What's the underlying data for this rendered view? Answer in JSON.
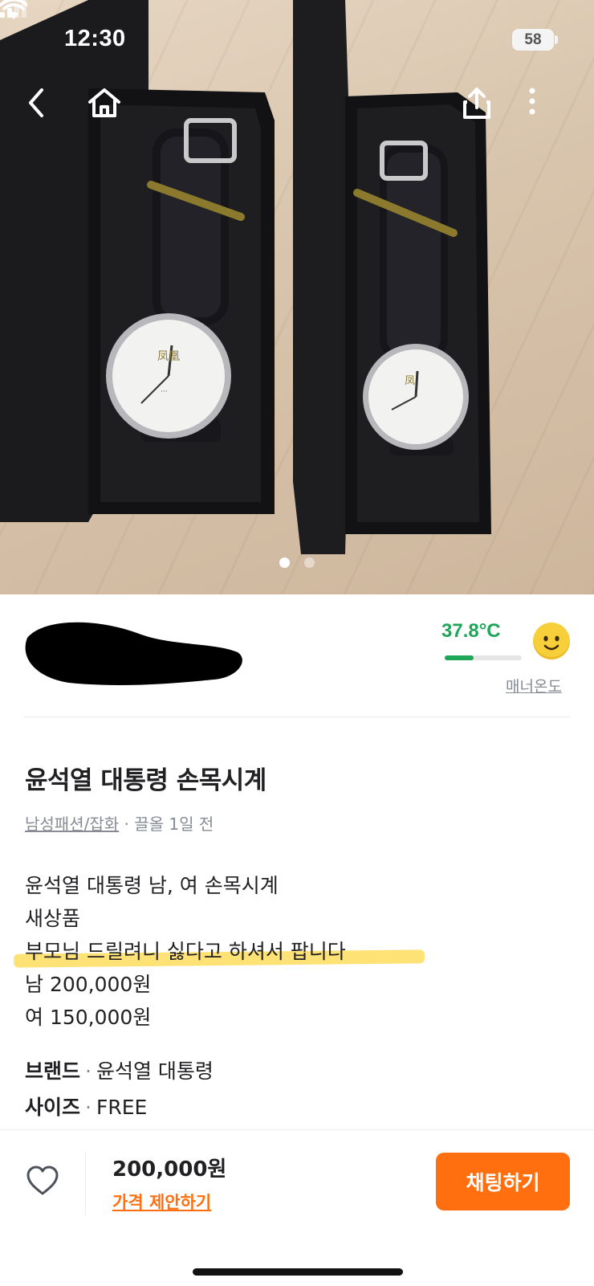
{
  "status_bar": {
    "time": "12:30",
    "battery": "58"
  },
  "nav": {
    "back_icon": "chevron-left-icon",
    "home_icon": "home-icon",
    "share_icon": "share-icon",
    "more_icon": "more-vertical-icon"
  },
  "photo": {
    "page_count": 2,
    "current_page": 1
  },
  "seller": {
    "temperature": "37.8°C",
    "temperature_level": 0.378,
    "temperature_caption": "매너온도",
    "temperature_color": "#1ea659"
  },
  "product": {
    "title": "윤석열 대통령 손목시계",
    "category": "남성패션/잡화",
    "bump_separator": " · ",
    "bump_time": "끌올 1일 전",
    "description": [
      "윤석열 대통령 남, 여 손목시계",
      "새상품",
      "부모님 드릴려니 싫다고 하셔서 팝니다",
      "남 200,000원",
      "여 150,000원"
    ],
    "attributes": [
      {
        "label": "브랜드",
        "separator": "·",
        "value": "윤석열 대통령"
      },
      {
        "label": "사이즈",
        "separator": "·",
        "value": "FREE"
      }
    ]
  },
  "bottom_bar": {
    "like_icon": "heart-outline-icon",
    "price": "200,000원",
    "offer_label": "가격 제안하기",
    "chat_label": "채팅하기",
    "accent_color": "#ff6f0f"
  }
}
